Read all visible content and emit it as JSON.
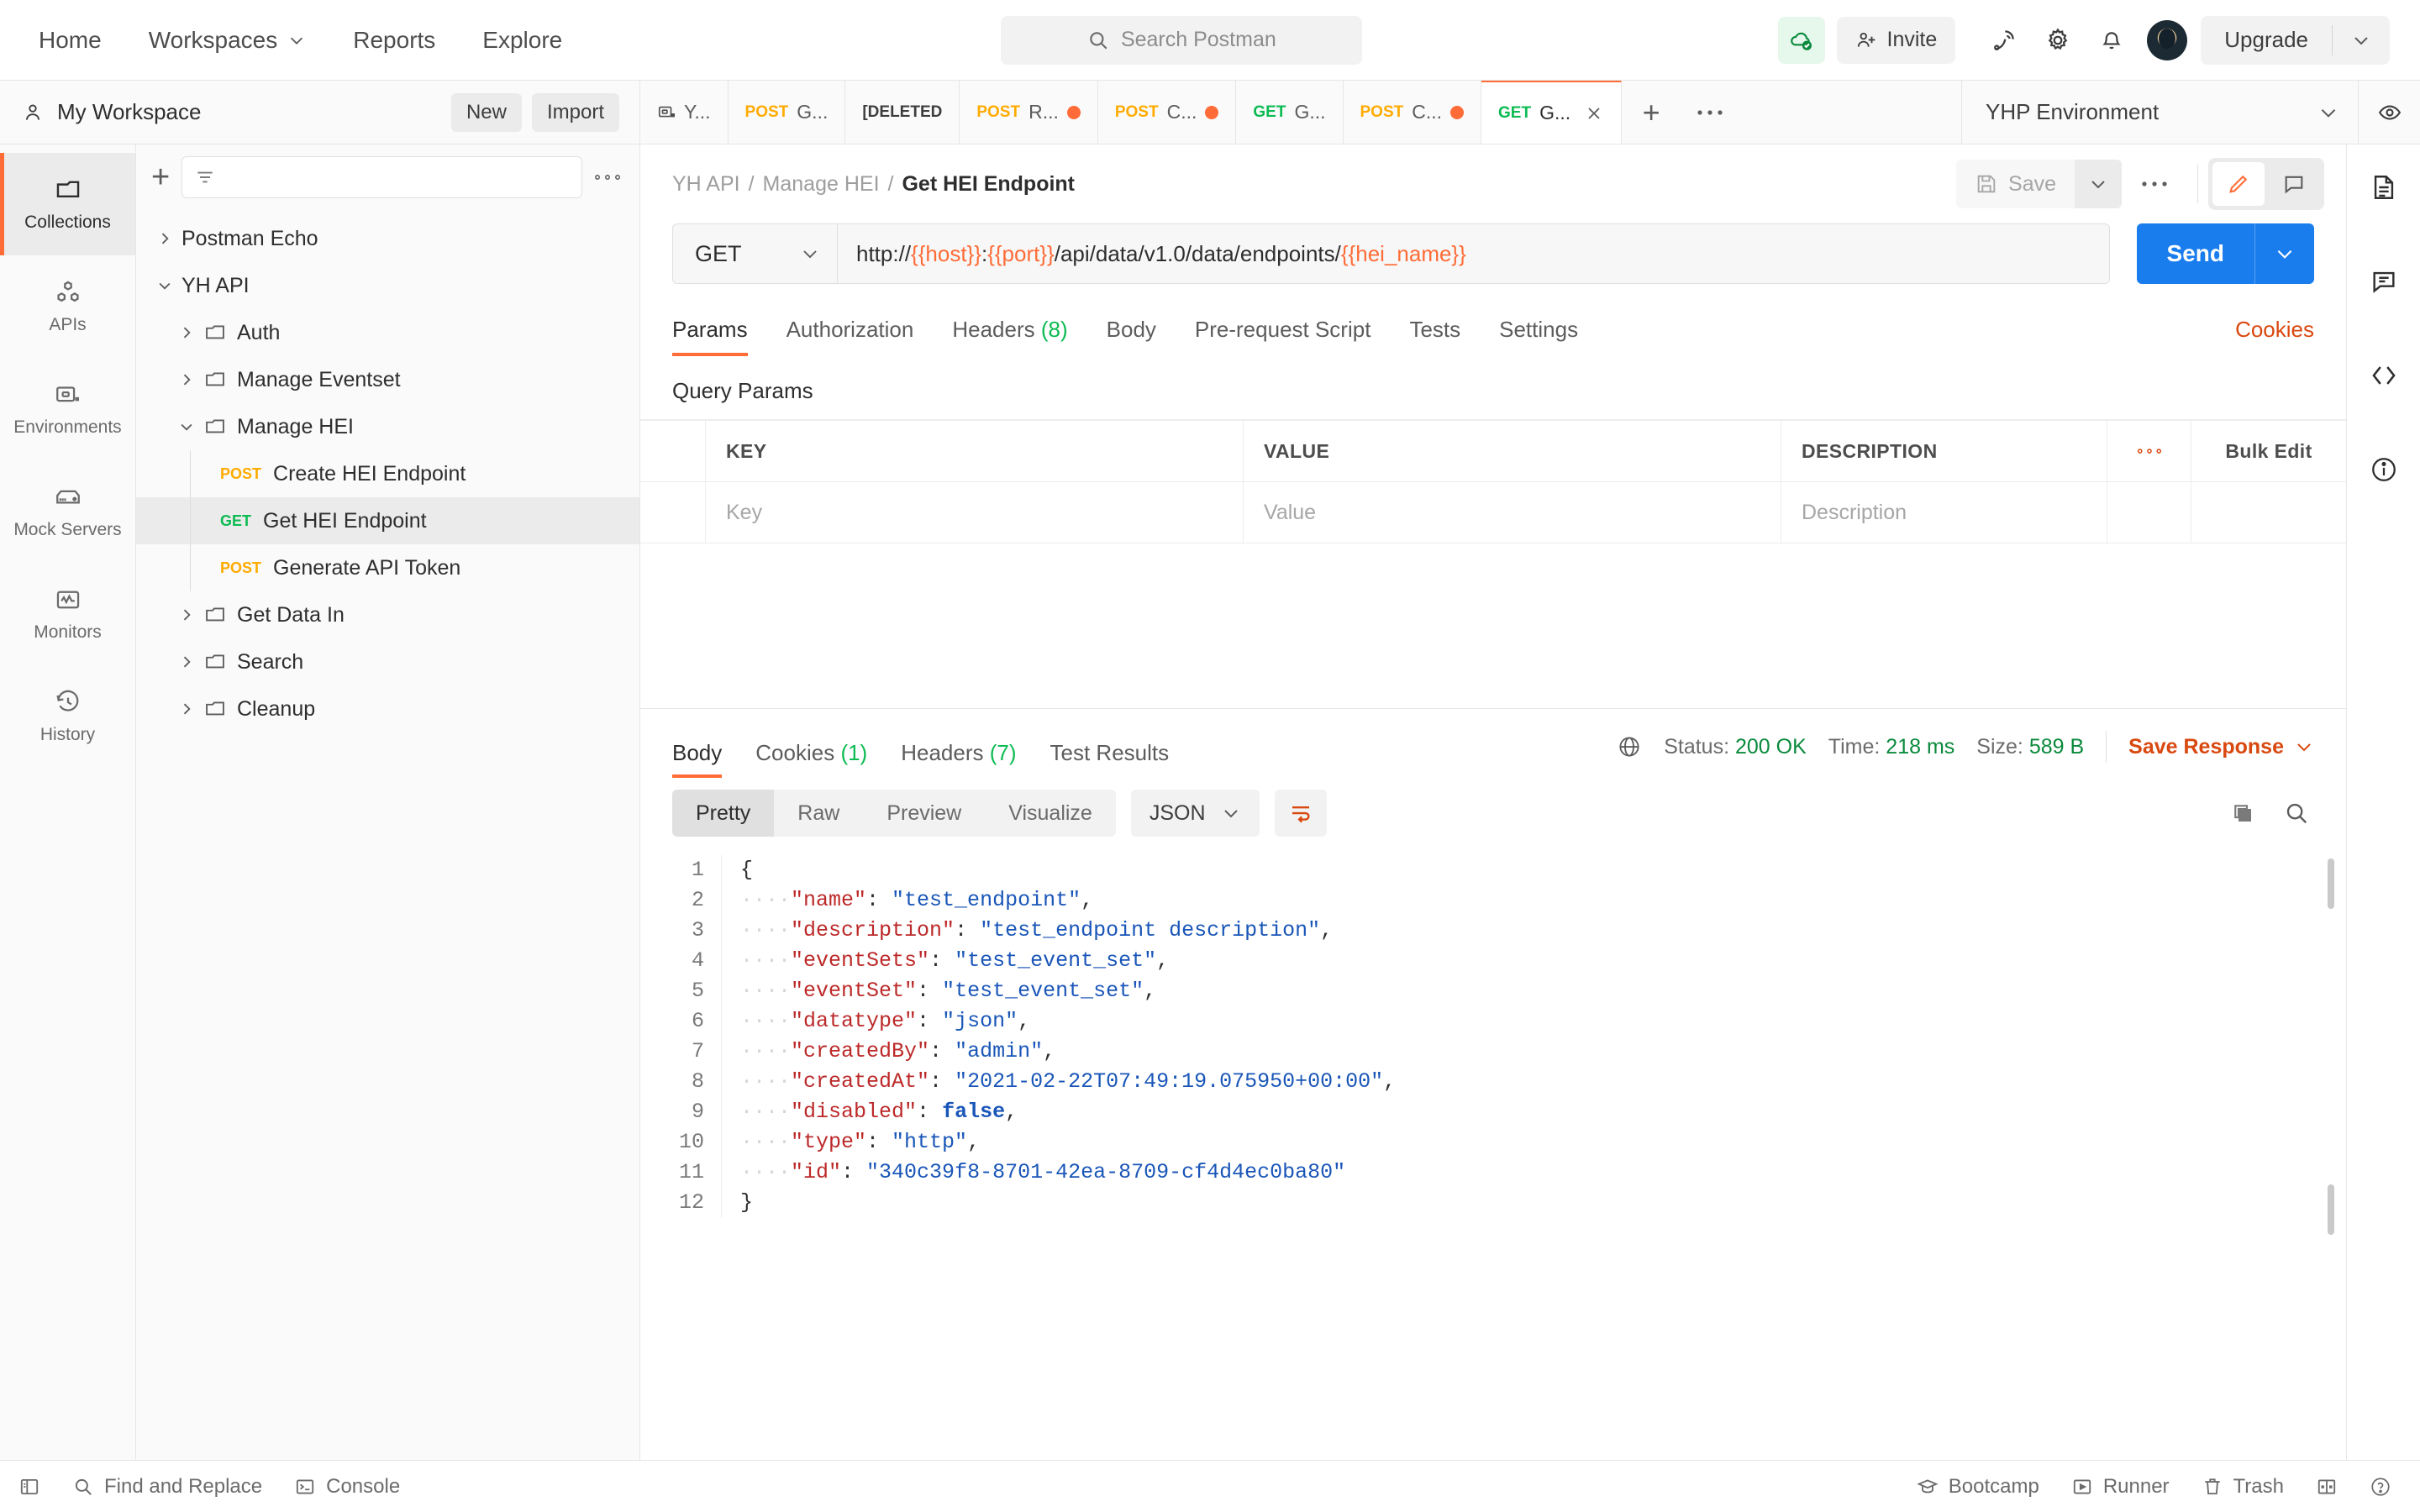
{
  "header": {
    "nav": [
      {
        "label": "Home",
        "has_caret": false
      },
      {
        "label": "Workspaces",
        "has_caret": true
      },
      {
        "label": "Reports",
        "has_caret": false
      },
      {
        "label": "Explore",
        "has_caret": false
      }
    ],
    "search_placeholder": "Search Postman",
    "invite_label": "Invite",
    "upgrade_label": "Upgrade",
    "icons": [
      "cloud-check-icon",
      "invite-icon",
      "satellite-icon",
      "gear-icon",
      "bell-icon",
      "avatar",
      "chevron-down-icon"
    ]
  },
  "workspace": {
    "name": "My Workspace",
    "new_label": "New",
    "import_label": "Import"
  },
  "tabs": [
    {
      "method": "",
      "label": "Y...",
      "icon": "environment-icon",
      "dirty": false,
      "active": false
    },
    {
      "method": "POST",
      "label": "G...",
      "dirty": false,
      "active": false
    },
    {
      "method": "",
      "label": "[DELETED",
      "deleted": true,
      "dirty": false,
      "active": false
    },
    {
      "method": "POST",
      "label": "R...",
      "dirty": true,
      "active": false
    },
    {
      "method": "POST",
      "label": "C...",
      "dirty": true,
      "active": false
    },
    {
      "method": "GET",
      "label": "G...",
      "dirty": false,
      "active": false
    },
    {
      "method": "POST",
      "label": "C...",
      "dirty": true,
      "active": false
    },
    {
      "method": "GET",
      "label": "G...",
      "dirty": false,
      "active": true
    }
  ],
  "environment": {
    "selected": "YHP Environment"
  },
  "rail": [
    {
      "label": "Collections",
      "icon": "collections-icon",
      "active": true
    },
    {
      "label": "APIs",
      "icon": "apis-icon",
      "active": false
    },
    {
      "label": "Environments",
      "icon": "environments-icon",
      "active": false
    },
    {
      "label": "Mock Servers",
      "icon": "mock-servers-icon",
      "active": false
    },
    {
      "label": "Monitors",
      "icon": "monitors-icon",
      "active": false
    },
    {
      "label": "History",
      "icon": "history-icon",
      "active": false
    }
  ],
  "sidebar": {
    "filter_placeholder": "",
    "tree": [
      {
        "label": "Postman Echo",
        "type": "collection",
        "level": 0,
        "expanded": false,
        "selected": false
      },
      {
        "label": "YH API",
        "type": "collection",
        "level": 0,
        "expanded": true,
        "selected": false
      },
      {
        "label": "Auth",
        "type": "folder",
        "level": 1,
        "expanded": false,
        "selected": false
      },
      {
        "label": "Manage Eventset",
        "type": "folder",
        "level": 1,
        "expanded": false,
        "selected": false
      },
      {
        "label": "Manage HEI",
        "type": "folder",
        "level": 1,
        "expanded": true,
        "selected": false
      },
      {
        "label": "Create HEI Endpoint",
        "type": "request",
        "method": "POST",
        "level": 2,
        "selected": false
      },
      {
        "label": "Get HEI Endpoint",
        "type": "request",
        "method": "GET",
        "level": 2,
        "selected": true
      },
      {
        "label": "Generate API Token",
        "type": "request",
        "method": "POST",
        "level": 2,
        "selected": false
      },
      {
        "label": "Get Data In",
        "type": "folder",
        "level": 1,
        "expanded": false,
        "selected": false
      },
      {
        "label": "Search",
        "type": "folder",
        "level": 1,
        "expanded": false,
        "selected": false
      },
      {
        "label": "Cleanup",
        "type": "folder",
        "level": 1,
        "expanded": false,
        "selected": false
      }
    ]
  },
  "request": {
    "breadcrumb": {
      "collection": "YH API",
      "folder": "Manage HEI",
      "name": "Get HEI Endpoint",
      "sep": "/"
    },
    "save_label": "Save",
    "method": "GET",
    "url_parts": [
      {
        "text": "http://",
        "var": false
      },
      {
        "text": "{{host}}",
        "var": true
      },
      {
        "text": ":",
        "var": false
      },
      {
        "text": "{{port}}",
        "var": true
      },
      {
        "text": "/api/data/v1.0/data/endpoints/",
        "var": false
      },
      {
        "text": "{{hei_name}}",
        "var": true
      }
    ],
    "send_label": "Send",
    "tabs": [
      {
        "label": "Params",
        "count": "",
        "active": true
      },
      {
        "label": "Authorization",
        "count": "",
        "active": false
      },
      {
        "label": "Headers",
        "count": "(8)",
        "active": false
      },
      {
        "label": "Body",
        "count": "",
        "active": false
      },
      {
        "label": "Pre-request Script",
        "count": "",
        "active": false
      },
      {
        "label": "Tests",
        "count": "",
        "active": false
      },
      {
        "label": "Settings",
        "count": "",
        "active": false
      }
    ],
    "cookies_link": "Cookies",
    "query_params_title": "Query Params",
    "table": {
      "headers": [
        "KEY",
        "VALUE",
        "DESCRIPTION"
      ],
      "bulk_edit_label": "Bulk Edit",
      "empty_row": {
        "key": "Key",
        "value": "Value",
        "description": "Description"
      }
    }
  },
  "response": {
    "tabs": [
      {
        "label": "Body",
        "count": "",
        "active": true
      },
      {
        "label": "Cookies",
        "count": "(1)",
        "active": false
      },
      {
        "label": "Headers",
        "count": "(7)",
        "active": false
      },
      {
        "label": "Test Results",
        "count": "",
        "active": false
      }
    ],
    "status_label": "Status:",
    "status_value": "200 OK",
    "time_label": "Time:",
    "time_value": "218 ms",
    "size_label": "Size:",
    "size_value": "589 B",
    "save_response_label": "Save Response",
    "view_modes": [
      {
        "label": "Pretty",
        "active": true
      },
      {
        "label": "Raw",
        "active": false
      },
      {
        "label": "Preview",
        "active": false
      },
      {
        "label": "Visualize",
        "active": false
      }
    ],
    "format": "JSON",
    "body_lines": [
      {
        "n": 1,
        "indent": 0,
        "tokens": [
          {
            "t": "{",
            "c": "p"
          }
        ]
      },
      {
        "n": 2,
        "indent": 1,
        "tokens": [
          {
            "t": "\"name\"",
            "c": "k"
          },
          {
            "t": ": ",
            "c": "p"
          },
          {
            "t": "\"test_endpoint\"",
            "c": "s"
          },
          {
            "t": ",",
            "c": "p"
          }
        ]
      },
      {
        "n": 3,
        "indent": 1,
        "tokens": [
          {
            "t": "\"description\"",
            "c": "k"
          },
          {
            "t": ": ",
            "c": "p"
          },
          {
            "t": "\"test_endpoint description\"",
            "c": "s"
          },
          {
            "t": ",",
            "c": "p"
          }
        ]
      },
      {
        "n": 4,
        "indent": 1,
        "tokens": [
          {
            "t": "\"eventSets\"",
            "c": "k"
          },
          {
            "t": ": ",
            "c": "p"
          },
          {
            "t": "\"test_event_set\"",
            "c": "s"
          },
          {
            "t": ",",
            "c": "p"
          }
        ]
      },
      {
        "n": 5,
        "indent": 1,
        "tokens": [
          {
            "t": "\"eventSet\"",
            "c": "k"
          },
          {
            "t": ": ",
            "c": "p"
          },
          {
            "t": "\"test_event_set\"",
            "c": "s"
          },
          {
            "t": ",",
            "c": "p"
          }
        ]
      },
      {
        "n": 6,
        "indent": 1,
        "tokens": [
          {
            "t": "\"datatype\"",
            "c": "k"
          },
          {
            "t": ": ",
            "c": "p"
          },
          {
            "t": "\"json\"",
            "c": "s"
          },
          {
            "t": ",",
            "c": "p"
          }
        ]
      },
      {
        "n": 7,
        "indent": 1,
        "tokens": [
          {
            "t": "\"createdBy\"",
            "c": "k"
          },
          {
            "t": ": ",
            "c": "p"
          },
          {
            "t": "\"admin\"",
            "c": "s"
          },
          {
            "t": ",",
            "c": "p"
          }
        ]
      },
      {
        "n": 8,
        "indent": 1,
        "tokens": [
          {
            "t": "\"createdAt\"",
            "c": "k"
          },
          {
            "t": ": ",
            "c": "p"
          },
          {
            "t": "\"2021-02-22T07:49:19.075950+00:00\"",
            "c": "s"
          },
          {
            "t": ",",
            "c": "p"
          }
        ]
      },
      {
        "n": 9,
        "indent": 1,
        "tokens": [
          {
            "t": "\"disabled\"",
            "c": "k"
          },
          {
            "t": ": ",
            "c": "p"
          },
          {
            "t": "false",
            "c": "b"
          },
          {
            "t": ",",
            "c": "p"
          }
        ]
      },
      {
        "n": 10,
        "indent": 1,
        "tokens": [
          {
            "t": "\"type\"",
            "c": "k"
          },
          {
            "t": ": ",
            "c": "p"
          },
          {
            "t": "\"http\"",
            "c": "s"
          },
          {
            "t": ",",
            "c": "p"
          }
        ]
      },
      {
        "n": 11,
        "indent": 1,
        "tokens": [
          {
            "t": "\"id\"",
            "c": "k"
          },
          {
            "t": ": ",
            "c": "p"
          },
          {
            "t": "\"340c39f8-8701-42ea-8709-cf4d4ec0ba80\"",
            "c": "s"
          }
        ]
      },
      {
        "n": 12,
        "indent": 0,
        "tokens": [
          {
            "t": "}",
            "c": "p"
          }
        ]
      }
    ]
  },
  "right_rail": [
    "documentation-icon",
    "comment-icon",
    "code-icon",
    "info-icon"
  ],
  "statusbar": {
    "left": [
      {
        "label": "",
        "icon": "sidebar-toggle-icon"
      },
      {
        "label": "Find and Replace",
        "icon": "search-icon"
      },
      {
        "label": "Console",
        "icon": "console-icon"
      }
    ],
    "right": [
      {
        "label": "Bootcamp",
        "icon": "bootcamp-icon"
      },
      {
        "label": "Runner",
        "icon": "runner-icon"
      },
      {
        "label": "Trash",
        "icon": "trash-icon"
      },
      {
        "label": "",
        "icon": "layout-icon"
      },
      {
        "label": "",
        "icon": "help-icon"
      }
    ]
  },
  "colors": {
    "accent": "#ff6c37",
    "send": "#1a7ded",
    "get": "#0cbb52",
    "post": "#ffab00",
    "link": "#d9480f"
  }
}
